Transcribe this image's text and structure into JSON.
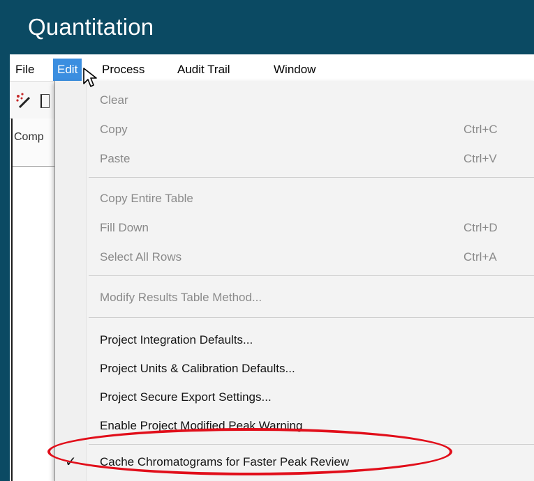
{
  "window": {
    "title": "Quantitation"
  },
  "menubar": {
    "items": [
      {
        "label": "File"
      },
      {
        "label": "Edit"
      },
      {
        "label": "Process"
      },
      {
        "label": "Audit Trail"
      },
      {
        "label": "Window"
      }
    ],
    "active": "Edit"
  },
  "toolbar": {
    "icons": [
      "wand-icon"
    ]
  },
  "panel": {
    "header": "Comp"
  },
  "dropdown": {
    "items": [
      {
        "label": "Clear",
        "shortcut": "",
        "enabled": false
      },
      {
        "label": "Copy",
        "shortcut": "Ctrl+C",
        "enabled": false
      },
      {
        "label": "Paste",
        "shortcut": "Ctrl+V",
        "enabled": false
      },
      {
        "label": "Copy Entire Table",
        "shortcut": "",
        "enabled": false
      },
      {
        "label": "Fill Down",
        "shortcut": "Ctrl+D",
        "enabled": false
      },
      {
        "label": "Select All Rows",
        "shortcut": "Ctrl+A",
        "enabled": false
      },
      {
        "label": "Modify Results Table Method...",
        "shortcut": "",
        "enabled": false
      },
      {
        "label": "Project Integration Defaults...",
        "shortcut": "",
        "enabled": true
      },
      {
        "label": "Project Units & Calibration Defaults...",
        "shortcut": "",
        "enabled": true
      },
      {
        "label": "Project Secure Export Settings...",
        "shortcut": "",
        "enabled": true
      },
      {
        "label": "Enable Project Modified Peak Warning",
        "shortcut": "",
        "enabled": true
      },
      {
        "label": "Cache Chromatograms for Faster Peak Review",
        "shortcut": "",
        "enabled": true,
        "checked": true
      }
    ],
    "check_glyph": "✓"
  },
  "colors": {
    "titlebar": "#0b4a63",
    "menu_highlight": "#3b8ee0",
    "annotation_ring": "#e10e1a"
  }
}
